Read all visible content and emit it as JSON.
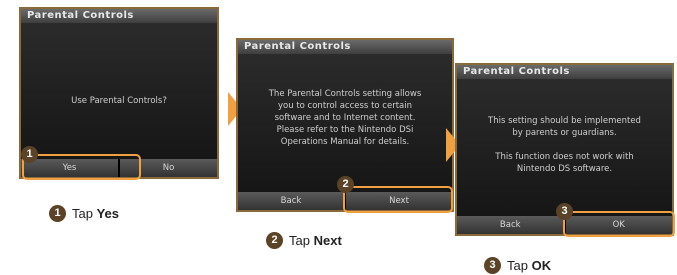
{
  "screens": [
    {
      "title": "Parental Controls",
      "message": [
        "Use Parental Controls?"
      ],
      "buttons": [
        "Yes",
        "No"
      ]
    },
    {
      "title": "Parental Controls",
      "message": [
        "The Parental Controls setting allows",
        "you to control access to certain",
        "software and to Internet content.",
        "Please refer to the Nintendo DSi",
        "Operations Manual for details."
      ],
      "buttons": [
        "Back",
        "Next"
      ]
    },
    {
      "title": "Parental Controls",
      "message": [
        "This setting should be implemented",
        "by parents or guardians.",
        "",
        "This function does not work with",
        "Nintendo DS software."
      ],
      "buttons": [
        "Back",
        "OK"
      ]
    }
  ],
  "steps": [
    {
      "number": "1",
      "verb": "Tap",
      "target": "Yes"
    },
    {
      "number": "2",
      "verb": "Tap",
      "target": "Next"
    },
    {
      "number": "3",
      "verb": "Tap",
      "target": "OK"
    }
  ],
  "colors": {
    "accent": "#f0a040",
    "badge": "#5a4326"
  }
}
